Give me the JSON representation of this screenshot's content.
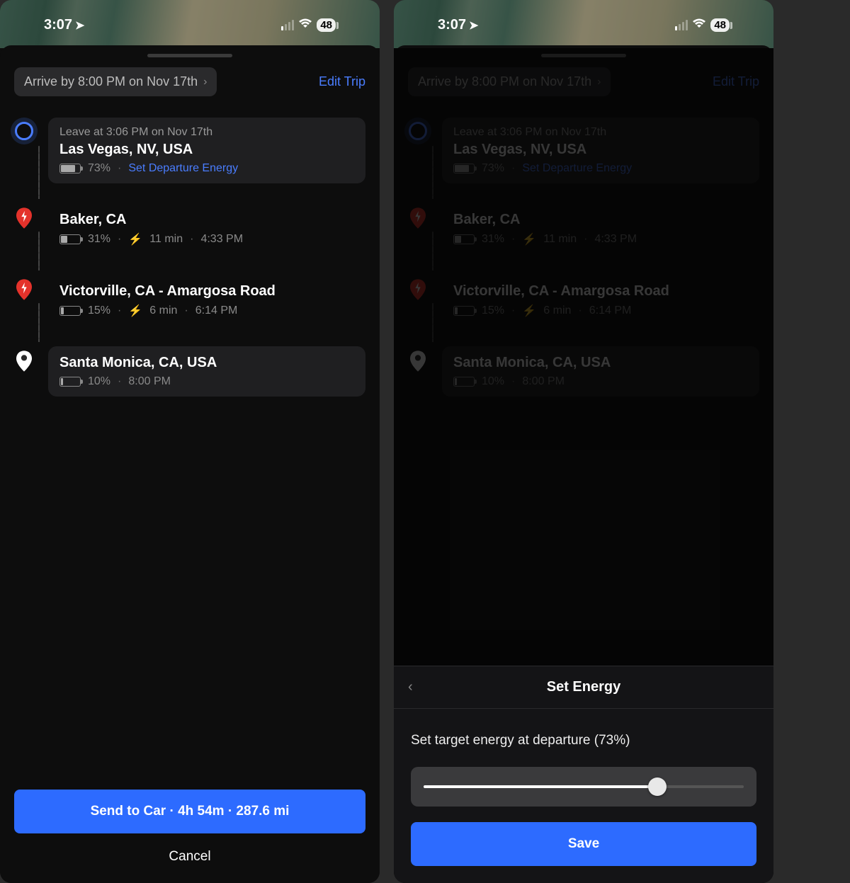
{
  "status": {
    "time": "3:07",
    "battery": "48"
  },
  "header": {
    "arrive_label": "Arrive by 8:00 PM on Nov 17th",
    "edit_label": "Edit Trip"
  },
  "stops": [
    {
      "leave": "Leave at 3:06 PM on Nov 17th",
      "place": "Las Vegas, NV, USA",
      "soc": "73%",
      "soc_fill": 73,
      "link": "Set Departure Energy"
    },
    {
      "place": "Baker, CA",
      "soc": "31%",
      "soc_fill": 31,
      "charge": "11 min",
      "eta": "4:33 PM"
    },
    {
      "place": "Victorville, CA - Amargosa Road",
      "soc": "15%",
      "soc_fill": 15,
      "charge": "6 min",
      "eta": "6:14 PM"
    },
    {
      "place": "Santa Monica, CA, USA",
      "soc": "10%",
      "soc_fill": 10,
      "eta": "8:00 PM"
    }
  ],
  "footer": {
    "send": "Send to Car · 4h 54m · 287.6 mi",
    "cancel": "Cancel"
  },
  "energy": {
    "title": "Set Energy",
    "label": "Set target energy at departure (73%)",
    "value_pct": 73,
    "save": "Save"
  }
}
